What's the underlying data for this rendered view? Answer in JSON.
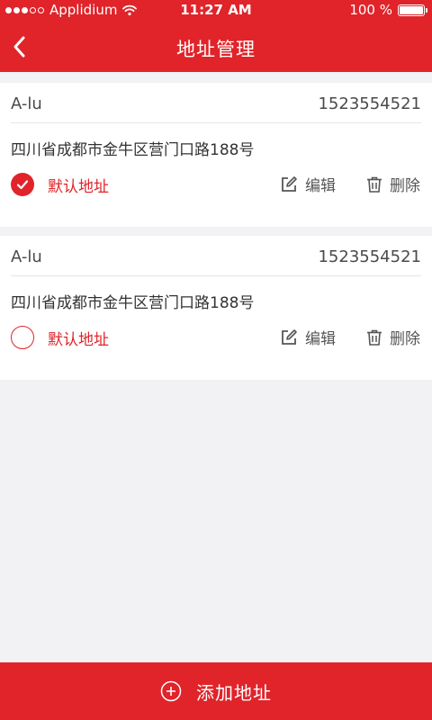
{
  "status_bar": {
    "carrier": "Applidium",
    "time": "11:27 AM",
    "battery": "100 %",
    "battery_level": 1.0
  },
  "nav": {
    "title": "地址管理"
  },
  "addresses": [
    {
      "name": "A-lu",
      "phone": "1523554521",
      "address": "四川省成都市金牛区营门口路188号",
      "default_label": "默认地址",
      "is_default": true,
      "edit_label": "编辑",
      "delete_label": "删除"
    },
    {
      "name": "A-lu",
      "phone": "1523554521",
      "address": "四川省成都市金牛区营门口路188号",
      "default_label": "默认地址",
      "is_default": false,
      "edit_label": "编辑",
      "delete_label": "删除"
    }
  ],
  "bottom": {
    "add_label": "添加地址"
  },
  "colors": {
    "accent": "#e0242a",
    "background": "#f2f2f4",
    "text": "#333333"
  }
}
